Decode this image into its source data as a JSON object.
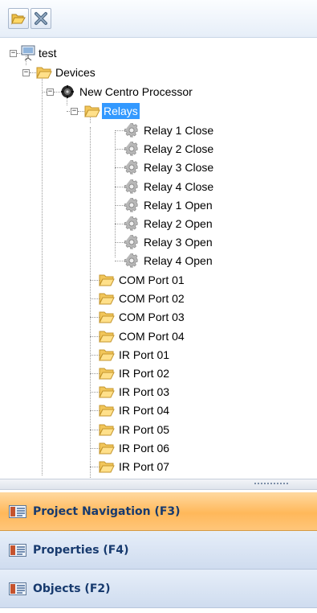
{
  "toolbar": {
    "buttons": [
      {
        "icon": "open-folder-icon"
      },
      {
        "icon": "delete-x-icon"
      }
    ]
  },
  "tree": {
    "root": "test",
    "devices": "Devices",
    "processor": "New Centro Processor",
    "relays_folder": "Relays",
    "relays": [
      "Relay 1 Close",
      "Relay 2 Close",
      "Relay 3 Close",
      "Relay 4 Close",
      "Relay 1 Open",
      "Relay 2 Open",
      "Relay 3 Open",
      "Relay 4 Open"
    ],
    "ports": [
      "COM Port 01",
      "COM Port 02",
      "COM Port 03",
      "COM Port 04",
      "IR Port 01",
      "IR Port 02",
      "IR Port 03",
      "IR Port 04",
      "IR Port 05",
      "IR Port 06",
      "IR Port 07"
    ]
  },
  "panes": [
    {
      "label": "Project Navigation (F3)",
      "active": true,
      "icon": "navigation-pane-icon"
    },
    {
      "label": "Properties (F4)",
      "active": false,
      "icon": "properties-pane-icon"
    },
    {
      "label": "Objects (F2)",
      "active": false,
      "icon": "objects-pane-icon"
    }
  ],
  "colors": {
    "selection": "#3399ff",
    "active_pane": "#ffb85a",
    "inactive_pane": "#d8e4f4",
    "pane_text": "#173a6e"
  }
}
